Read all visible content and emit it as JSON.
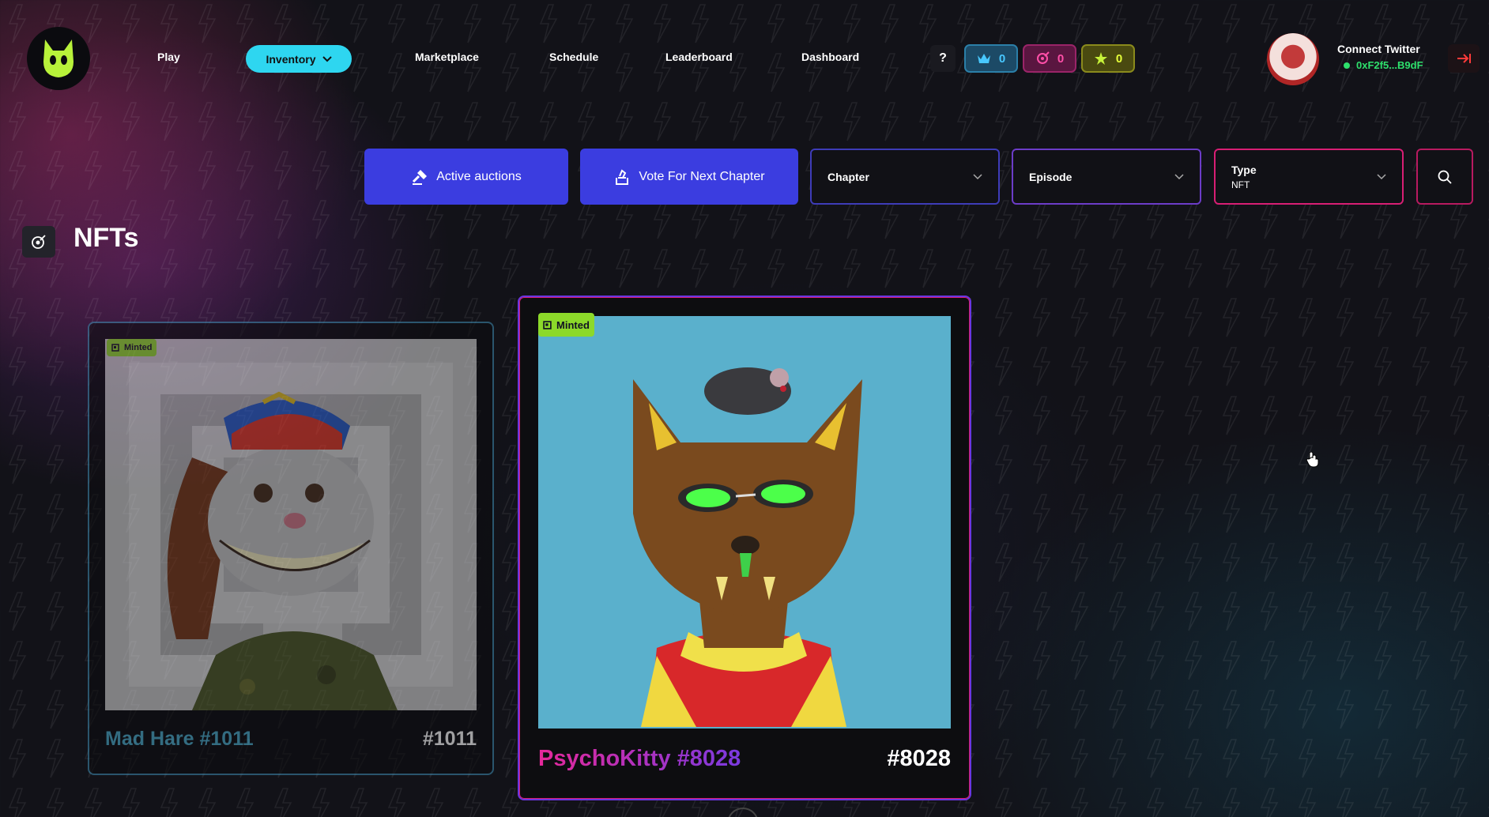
{
  "nav": {
    "links": {
      "play": "Play",
      "inventory": "Inventory",
      "marketplace": "Marketplace",
      "schedule": "Schedule",
      "leaderboard": "Leaderboard",
      "dashboard": "Dashboard"
    },
    "help": "?",
    "counters": {
      "crown": "0",
      "target": "0",
      "star": "0"
    },
    "connect_twitter": "Connect Twitter",
    "wallet": "0xF2f5...B9dF"
  },
  "filters": {
    "active_auctions": "Active auctions",
    "vote": "Vote For Next Chapter",
    "chapter": {
      "label": "Chapter"
    },
    "episode": {
      "label": "Episode"
    },
    "type": {
      "label": "Type",
      "value": "NFT"
    }
  },
  "section": {
    "title": "NFTs"
  },
  "cards": [
    {
      "badge": "Minted",
      "name": "Mad Hare #1011",
      "number": "#1011",
      "name_color": "#4aa8c8"
    },
    {
      "badge": "Minted",
      "name": "PsychoKitty #8028",
      "number": "#8028",
      "name_color": "#e6289a"
    }
  ],
  "colors": {
    "accent_cyan": "#2ed6f0",
    "button_blue": "#3b3de0",
    "minted_green": "#8cd92a",
    "wallet_green": "#2ee06c"
  }
}
